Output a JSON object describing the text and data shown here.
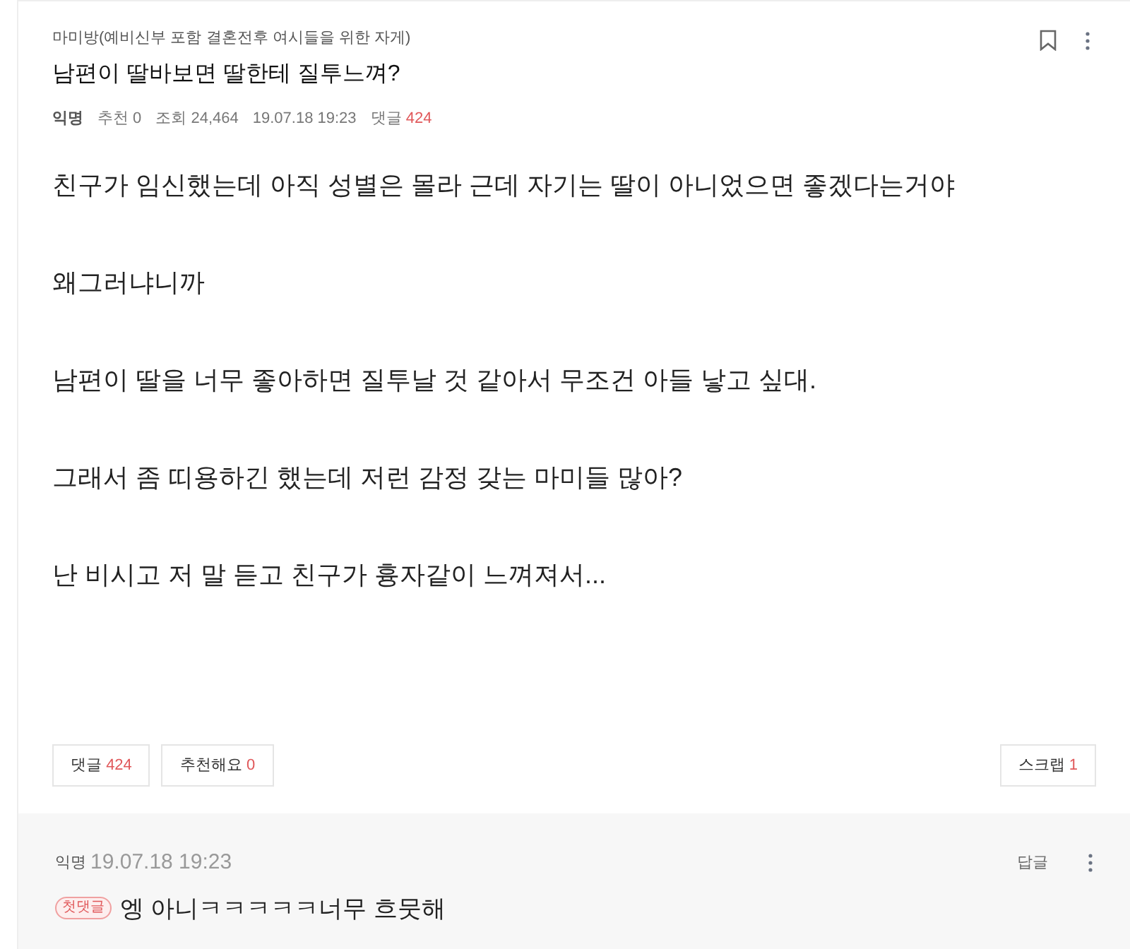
{
  "post": {
    "board": "마미방(예비신부 포함 결혼전후 여시들을 위한 자게)",
    "title": "남편이 딸바보면 딸한테 질투느껴?",
    "meta": {
      "author": "익명",
      "likes_label": "추천 0",
      "views_label": "조회 24,464",
      "date": "19.07.18 19:23",
      "comments_label": "댓글",
      "comments_count": "424"
    },
    "paragraphs": [
      "친구가 임신했는데 아직 성별은 몰라 근데 자기는 딸이 아니었으면 좋겠다는거야",
      "왜그러냐니까",
      "남편이 딸을 너무 좋아하면 질투날 것 같아서 무조건 아들 낳고 싶대.",
      "그래서 좀 띠용하긴 했는데 저런 감정 갖는 마미들 많아?",
      "난 비시고 저 말 듣고 친구가 흉자같이 느껴져서..."
    ],
    "buttons": [
      {
        "label": "댓글",
        "count": "424"
      },
      {
        "label": "추천해요",
        "count": "0"
      }
    ],
    "scrap": {
      "label": "스크랩",
      "count": "1"
    }
  },
  "comment": {
    "author": "익명",
    "date": "19.07.18 19:23",
    "reply": "답글",
    "badge": "첫댓글",
    "text": "엥 아니ㅋㅋㅋㅋㅋ너무 흐뭇해"
  }
}
